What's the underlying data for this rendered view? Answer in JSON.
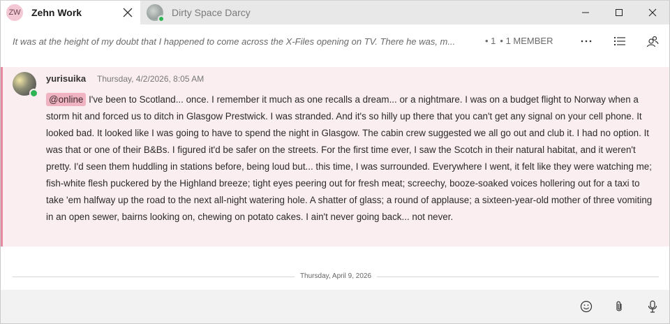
{
  "tabs": [
    {
      "label": "Zehn Work",
      "initials": "ZW",
      "active": true
    },
    {
      "label": "Dirty Space Darcy",
      "active": false
    }
  ],
  "header": {
    "topic": "It was at the height of my doubt that I happened to come across the X-Files opening on TV. There he was, m...",
    "count": "• 1",
    "members": "• 1 MEMBER"
  },
  "message": {
    "author": "yurisuika",
    "timestamp": "Thursday, 4/2/2026, 8:05 AM",
    "mention": "@online",
    "text": " I've been to Scotland... once. I remember it much as one recalls a dream... or a nightmare. I was on a budget flight to Norway when a storm hit and forced us to ditch in Glasgow Prestwick. I was stranded. And it's so hilly up there that you can't get any signal on your cell phone. It looked bad. It looked like I was going to have to spend the night in Glasgow. The cabin crew suggested we all go out and club it. I had no option. It was that or one of their B&Bs. I figured it'd be safer on the streets. For the first time ever, I saw the Scotch in their natural habitat, and it weren't pretty. I'd seen them huddling in stations before, being loud but... this time, I was surrounded. Everywhere I went, it felt like they were watching me; fish-white flesh puckered by the Highland breeze; tight eyes peering out for fresh meat; screechy, booze-soaked voices hollering out for a taxi to take 'em halfway up the road to the next all-night watering hole. A shatter of glass; a round of applause; a sixteen-year-old mother of three vomiting in an open sewer, bairns looking on, chewing on potato cakes. I ain't never going back... not never."
  },
  "divider": {
    "date": "Thursday, April 9, 2026"
  },
  "icons": {
    "tab_close": "close-icon",
    "window": [
      "minimize-icon",
      "maximize-icon",
      "close-icon"
    ],
    "header": [
      "more-icon",
      "list-icon",
      "members-icon"
    ],
    "composer": [
      "emoji-icon",
      "attach-icon",
      "microphone-icon"
    ]
  },
  "colors": {
    "accent": "#e58aa0",
    "mention_bg": "#f0b3c2",
    "message_bg": "#fbeef1",
    "presence": "#2fb455"
  }
}
